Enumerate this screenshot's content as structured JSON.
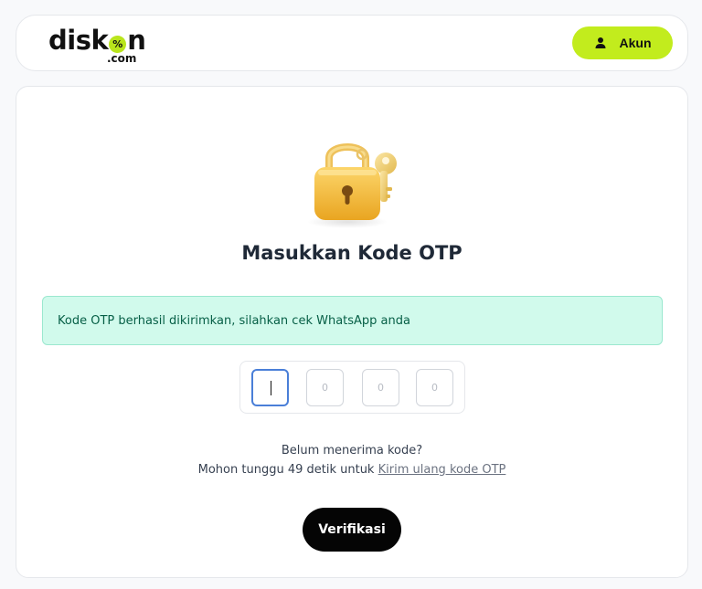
{
  "header": {
    "logo_left": "disk",
    "logo_badge": "%",
    "logo_right": "n",
    "logo_sub": ".com",
    "account_label": "Akun"
  },
  "main": {
    "title": "Masukkan Kode OTP",
    "alert_text": "Kode OTP berhasil dikirimkan, silahkan cek WhatsApp anda",
    "otp_inputs": [
      {
        "value": "",
        "placeholder": ""
      },
      {
        "value": "",
        "placeholder": "0"
      },
      {
        "value": "",
        "placeholder": "0"
      },
      {
        "value": "",
        "placeholder": "0"
      }
    ],
    "resend_question": "Belum menerima kode?",
    "resend_prefix": "Mohon tunggu 49 detik untuk ",
    "resend_link": "Kirim ulang kode OTP",
    "verify_label": "Verifikasi"
  },
  "colors": {
    "accent": "#c2ec1d",
    "alert_bg": "#d1faec",
    "primary_button": "#050505"
  },
  "icons": {
    "account": "person-icon",
    "illustration": "padlock-key-icon"
  }
}
